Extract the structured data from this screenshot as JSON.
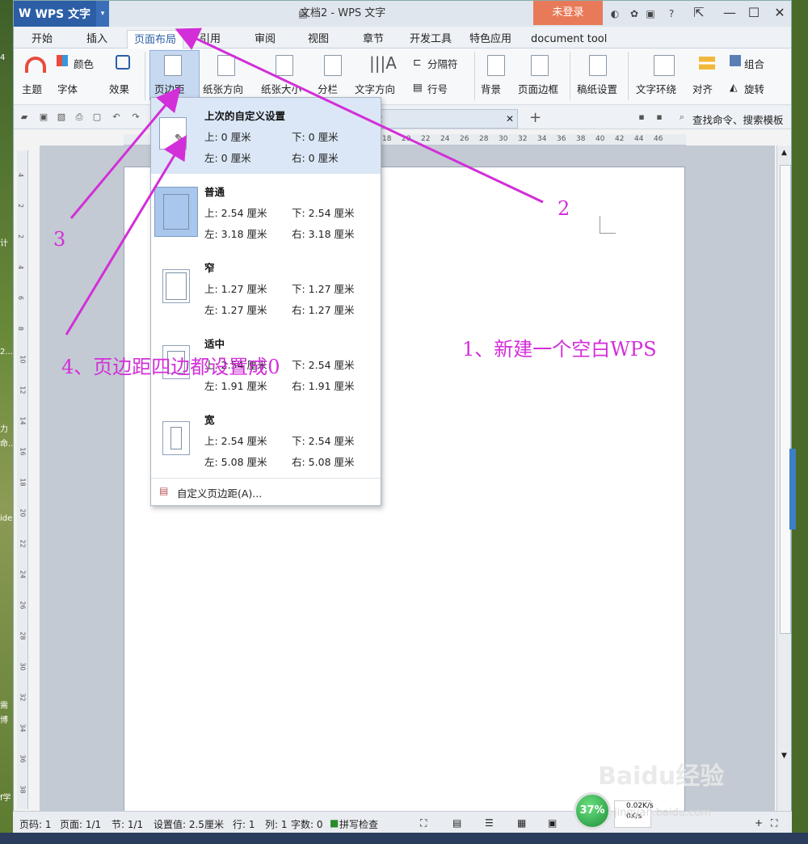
{
  "app": {
    "name": "WPS 文字",
    "title": "文档2 - WPS 文字",
    "login": "未登录"
  },
  "tabs": [
    "开始",
    "插入",
    "页面布局",
    "引用",
    "审阅",
    "视图",
    "章节",
    "开发工具",
    "特色应用",
    "document tool"
  ],
  "active_tab": "页面布局",
  "ribbon": {
    "theme": "主题",
    "color": "颜色",
    "font": "字体",
    "effect": "效果",
    "margins": "页边距",
    "orientation": "纸张方向",
    "size": "纸张大小",
    "columns": "分栏",
    "text_direction": "文字方向",
    "separator": "分隔符",
    "line_number": "行号",
    "background": "背景",
    "page_border": "页面边框",
    "draft_paper": "稿纸设置",
    "text_wrap": "文字环绕",
    "align": "对齐",
    "group": "组合",
    "rotate": "旋转"
  },
  "doc_tab": "档2",
  "search": "查找命令、搜索模板",
  "ruler_numbers": [
    "18",
    "20",
    "22",
    "24",
    "26",
    "28",
    "30",
    "32",
    "34",
    "36",
    "38",
    "40",
    "42",
    "44",
    "46"
  ],
  "vruler_numbers": [
    "4",
    "2",
    "2",
    "4",
    "6",
    "8",
    "10",
    "12",
    "14",
    "16",
    "18",
    "20",
    "22",
    "24",
    "26",
    "28",
    "30",
    "32",
    "34",
    "36",
    "38"
  ],
  "menu": {
    "presets": [
      {
        "name": "上次的自定义设置",
        "top": "上: 0 厘米",
        "bottom": "下: 0 厘米",
        "left": "左: 0 厘米",
        "right": "右: 0 厘米"
      },
      {
        "name": "普通",
        "top": "上: 2.54 厘米",
        "bottom": "下: 2.54 厘米",
        "left": "左: 3.18 厘米",
        "right": "右: 3.18 厘米"
      },
      {
        "name": "窄",
        "top": "上: 1.27 厘米",
        "bottom": "下: 1.27 厘米",
        "left": "左: 1.27 厘米",
        "right": "右: 1.27 厘米"
      },
      {
        "name": "适中",
        "top": "上: 2.54 厘米",
        "bottom": "下: 2.54 厘米",
        "left": "左: 1.91 厘米",
        "right": "右: 1.91 厘米"
      },
      {
        "name": "宽",
        "top": "上: 2.54 厘米",
        "bottom": "下: 2.54 厘米",
        "left": "左: 5.08 厘米",
        "right": "右: 5.08 厘米"
      }
    ],
    "custom": "自定义页边距(A)..."
  },
  "status": {
    "page": "页码: 1",
    "pages": "页面: 1/1",
    "section": "节: 1/1",
    "setting": "设置值: 2.5厘米",
    "row": "行: 1",
    "col": "列: 1",
    "words": "字数: 0",
    "spell": "拼写检查",
    "speed": "37%",
    "net_up": "0.02K/s",
    "net_down": "0K/s"
  },
  "annotations": {
    "step1": "1、新建一个空白WPS",
    "step2": "2",
    "step3": "3",
    "step4": "4、页边距四边都设置成0"
  },
  "watermark": "Baidu经验",
  "watermark_url": "jingyan.baidu.com",
  "desktop_texts": [
    "4",
    "计",
    "2...",
    "力",
    "命...",
    "ide",
    "需",
    "博",
    "f学"
  ],
  "colors": {
    "accent": "#2b5ea5",
    "login": "#e87a59",
    "annotation": "#d22fd8",
    "highlight": "#dbe7f6"
  }
}
